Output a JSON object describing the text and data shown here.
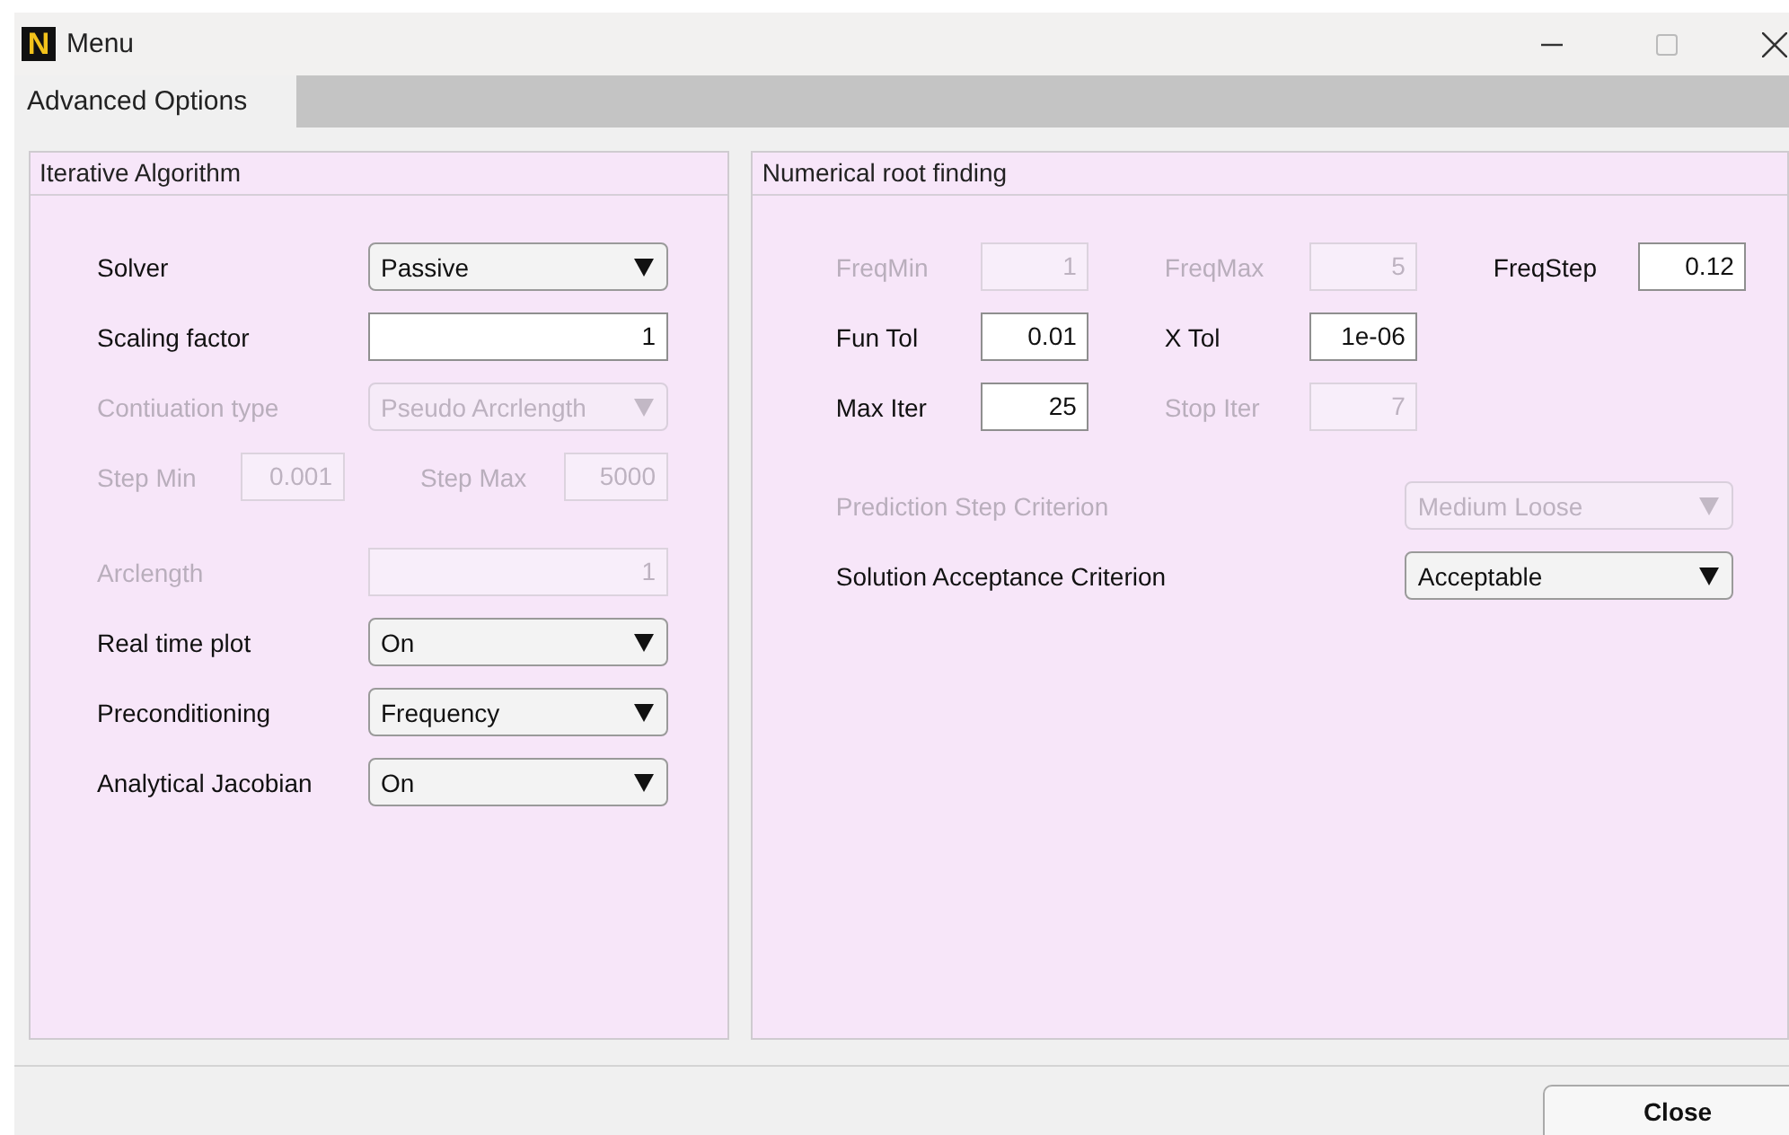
{
  "window": {
    "logo_letter": "N",
    "title": "Menu"
  },
  "tabs": [
    {
      "label": "Advanced Options",
      "selected": true
    }
  ],
  "panels": [
    {
      "title": "Iterative Algorithm",
      "rows": [
        {
          "items": [
            {
              "kind": "dropdown",
              "label": "Solver",
              "value": "Passive",
              "disabled": false
            }
          ]
        },
        {
          "items": [
            {
              "kind": "field",
              "label": "Scaling factor",
              "value": "1",
              "disabled": false
            }
          ]
        },
        {
          "items": [
            {
              "kind": "dropdown",
              "label": "Contiuation type",
              "value": "Pseudo Arcrlength",
              "disabled": true
            }
          ]
        },
        {
          "items": [
            {
              "kind": "field",
              "label": "Step Min",
              "value": "0.001",
              "disabled": true
            },
            {
              "kind": "field",
              "label": "Step Max",
              "value": "5000",
              "disabled": true
            }
          ]
        },
        {
          "items": [
            {
              "kind": "field",
              "label": "Arclength",
              "value": "1",
              "disabled": true
            }
          ]
        },
        {
          "items": [
            {
              "kind": "dropdown",
              "label": "Real time plot",
              "value": "On",
              "disabled": false
            }
          ]
        },
        {
          "items": [
            {
              "kind": "dropdown",
              "label": "Preconditioning",
              "value": "Frequency",
              "disabled": false
            }
          ]
        },
        {
          "items": [
            {
              "kind": "dropdown",
              "label": "Analytical Jacobian",
              "value": "On",
              "disabled": false
            }
          ]
        }
      ]
    },
    {
      "title": "Numerical root finding",
      "rows": [
        {
          "items": [
            {
              "kind": "field",
              "label": "FreqMin",
              "value": "1",
              "disabled": true
            },
            {
              "kind": "field",
              "label": "FreqMax",
              "value": "5",
              "disabled": true
            },
            {
              "kind": "field",
              "label": "FreqStep",
              "value": "0.12",
              "disabled": false
            }
          ]
        },
        {
          "items": [
            {
              "kind": "field",
              "label": "Fun Tol",
              "value": "0.01",
              "disabled": false
            },
            {
              "kind": "field",
              "label": "X Tol",
              "value": "1e-06",
              "disabled": false
            }
          ]
        },
        {
          "items": [
            {
              "kind": "field",
              "label": "Max Iter",
              "value": "25",
              "disabled": false
            },
            {
              "kind": "field",
              "label": "Stop Iter",
              "value": "7",
              "disabled": true
            }
          ]
        },
        {
          "items": [
            {
              "kind": "dropdown",
              "label": "Prediction Step Criterion",
              "value": "Medium Loose",
              "disabled": true
            }
          ]
        },
        {
          "items": [
            {
              "kind": "dropdown",
              "label": "Solution Acceptance Criterion",
              "value": "Acceptable",
              "disabled": false
            }
          ]
        }
      ]
    }
  ],
  "buttons": [
    {
      "label": "Close"
    }
  ]
}
